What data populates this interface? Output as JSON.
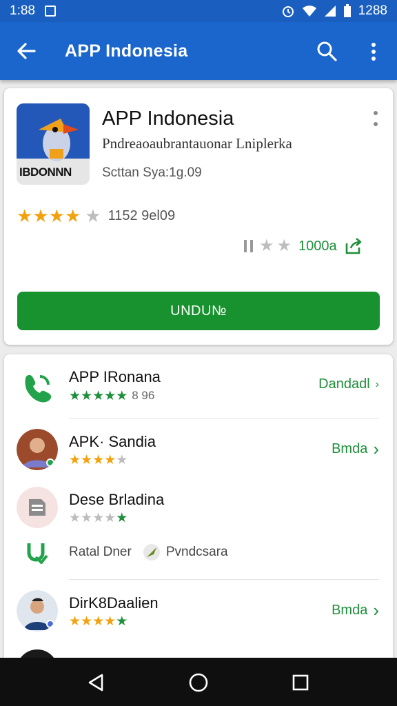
{
  "status_bar": {
    "time": "1:88",
    "right_text": "1288"
  },
  "app_bar": {
    "title": "APP Indonesia"
  },
  "app": {
    "logo_caption": "IBDONNN",
    "name": "APP  Indonesia",
    "subtitle": "Pndreaoaubrantauonar Lniplerka",
    "developer": "Scttan Sya:1g.09",
    "rating": 4.5,
    "rating_count": "1152 9el09",
    "download_count": "1000a",
    "install_label": "UNDU№"
  },
  "related": [
    {
      "name": "APP IRonana",
      "stars": "★★★★★",
      "star_suffix": "8 96",
      "action": "Dandadl",
      "icon": "phone-icon"
    },
    {
      "name": "APK· Sandia",
      "action": "Bmda",
      "icon": "avatar-man-icon"
    },
    {
      "name": "Dese Brladina",
      "action": "",
      "icon": "document-icon"
    },
    {
      "name": "DirK8Daalien",
      "action": "Bmda",
      "icon": "avatar-man-icon"
    }
  ],
  "sub_row": {
    "left": "Ratal Dner",
    "right": "Pvndcsara"
  },
  "colors": {
    "primary": "#1a66cc",
    "accent": "#17922e",
    "star": "#f2a20e"
  }
}
